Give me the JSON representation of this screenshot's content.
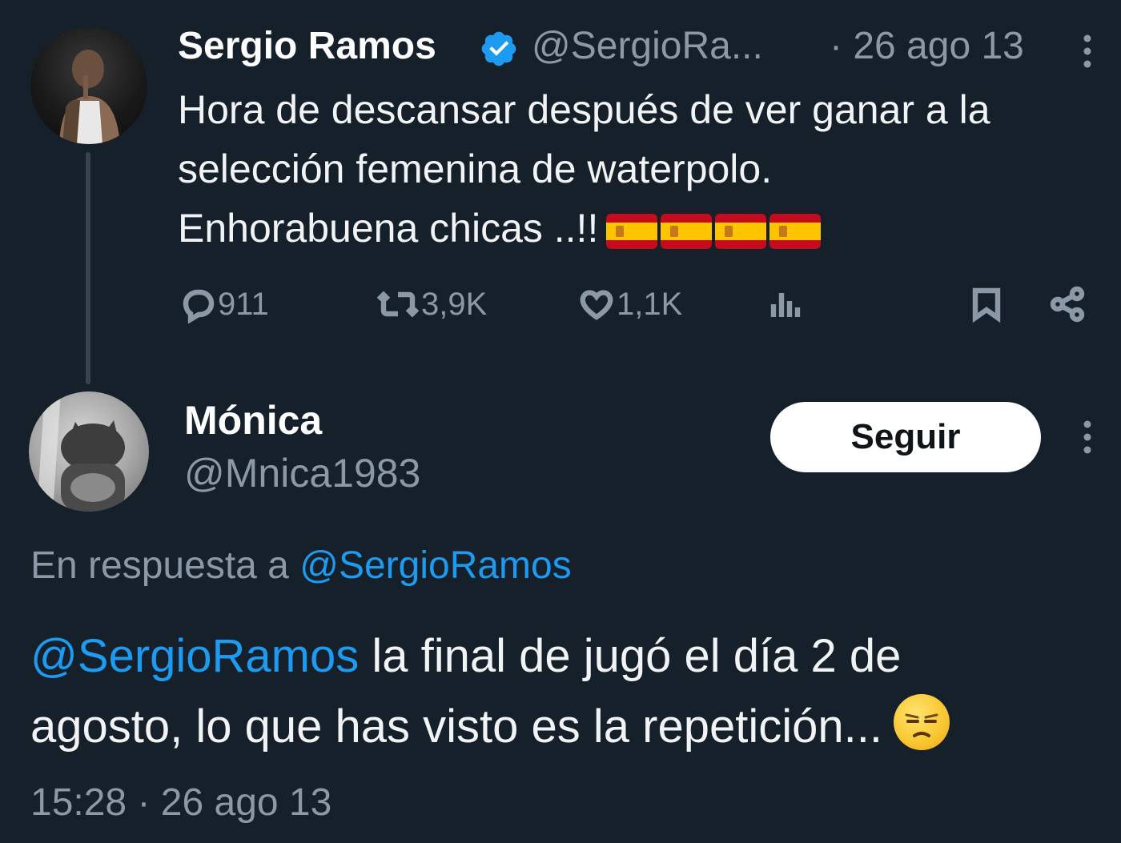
{
  "parent_tweet": {
    "author_name": "Sergio Ramos",
    "handle": "@SergioRa...",
    "date": "· 26 ago 13",
    "text_lines": [
      "Hora de descansar después de ver ganar a la",
      "selección femenina de waterpolo.",
      "Enhorabuena chicas ..!!"
    ],
    "emoji_flags": [
      "🇪🇸",
      "🇪🇸",
      "🇪🇸",
      "🇪🇸"
    ],
    "verified": true,
    "actions": {
      "replies": "911",
      "retweets": "3,9K",
      "likes": "1,1K"
    }
  },
  "reply_tweet": {
    "author_name": "Mónica",
    "handle": "@Mnica1983",
    "follow_label": "Seguir",
    "reply_to_prefix": "En respuesta a",
    "reply_to_handle": "@SergioRamos",
    "mention": "@SergioRamos",
    "text_line1_rest": "la final de jugó el día 2 de",
    "text_line2": "agosto, lo que has visto es la repetición...",
    "emoji": "😒",
    "timestamp": "15:28 · 26 ago 13"
  },
  "colors": {
    "background": "#15202b",
    "link": "#1d9bf0",
    "muted": "#8b98a5",
    "verified": "#1d9bf0"
  },
  "icons": [
    "verified-badge-icon",
    "more-options-icon",
    "reply-icon",
    "retweet-icon",
    "like-icon",
    "views-icon",
    "bookmark-icon",
    "share-icon",
    "unamused-face-icon",
    "spain-flag-icon"
  ]
}
